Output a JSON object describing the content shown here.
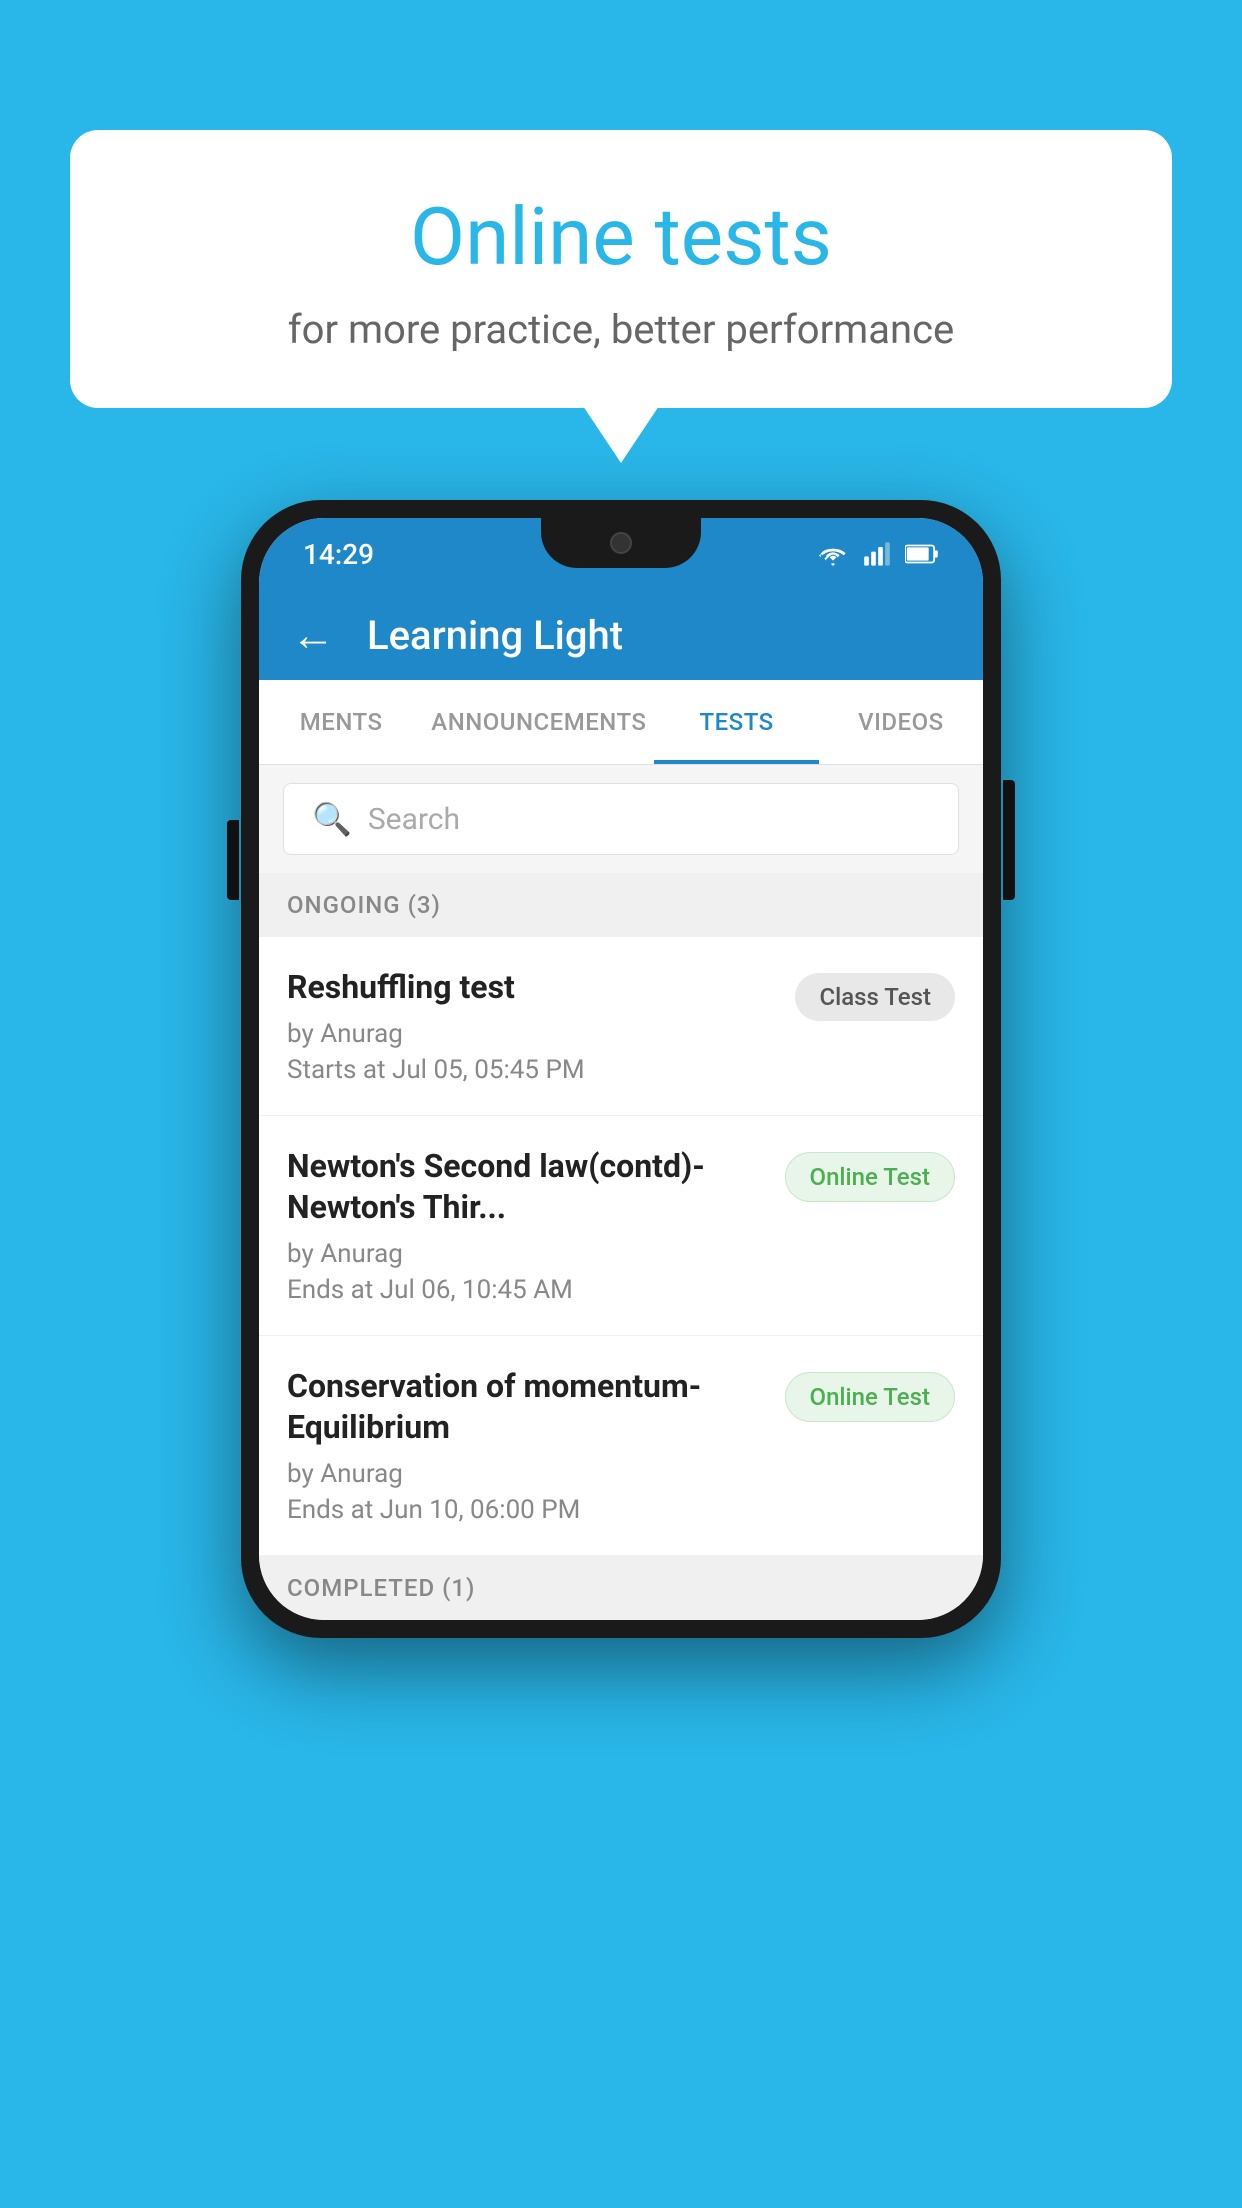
{
  "background_color": "#29b6e8",
  "bubble": {
    "title": "Online tests",
    "subtitle": "for more practice, better performance"
  },
  "phone": {
    "status_bar": {
      "time": "14:29",
      "icons": [
        "wifi",
        "signal",
        "battery"
      ]
    },
    "app_header": {
      "back_label": "←",
      "title": "Learning Light"
    },
    "tabs": [
      {
        "label": "MENTS",
        "active": false
      },
      {
        "label": "ANNOUNCEMENTS",
        "active": false
      },
      {
        "label": "TESTS",
        "active": true
      },
      {
        "label": "VIDEOS",
        "active": false
      }
    ],
    "search": {
      "placeholder": "Search"
    },
    "section_ongoing": {
      "label": "ONGOING (3)"
    },
    "tests": [
      {
        "name": "Reshuffling test",
        "author": "by Anurag",
        "date": "Starts at  Jul 05, 05:45 PM",
        "badge": "Class Test",
        "badge_type": "class"
      },
      {
        "name": "Newton's Second law(contd)-Newton's Thir...",
        "author": "by Anurag",
        "date": "Ends at  Jul 06, 10:45 AM",
        "badge": "Online Test",
        "badge_type": "online"
      },
      {
        "name": "Conservation of momentum-Equilibrium",
        "author": "by Anurag",
        "date": "Ends at  Jun 10, 06:00 PM",
        "badge": "Online Test",
        "badge_type": "online"
      }
    ],
    "section_completed": {
      "label": "COMPLETED (1)"
    }
  }
}
